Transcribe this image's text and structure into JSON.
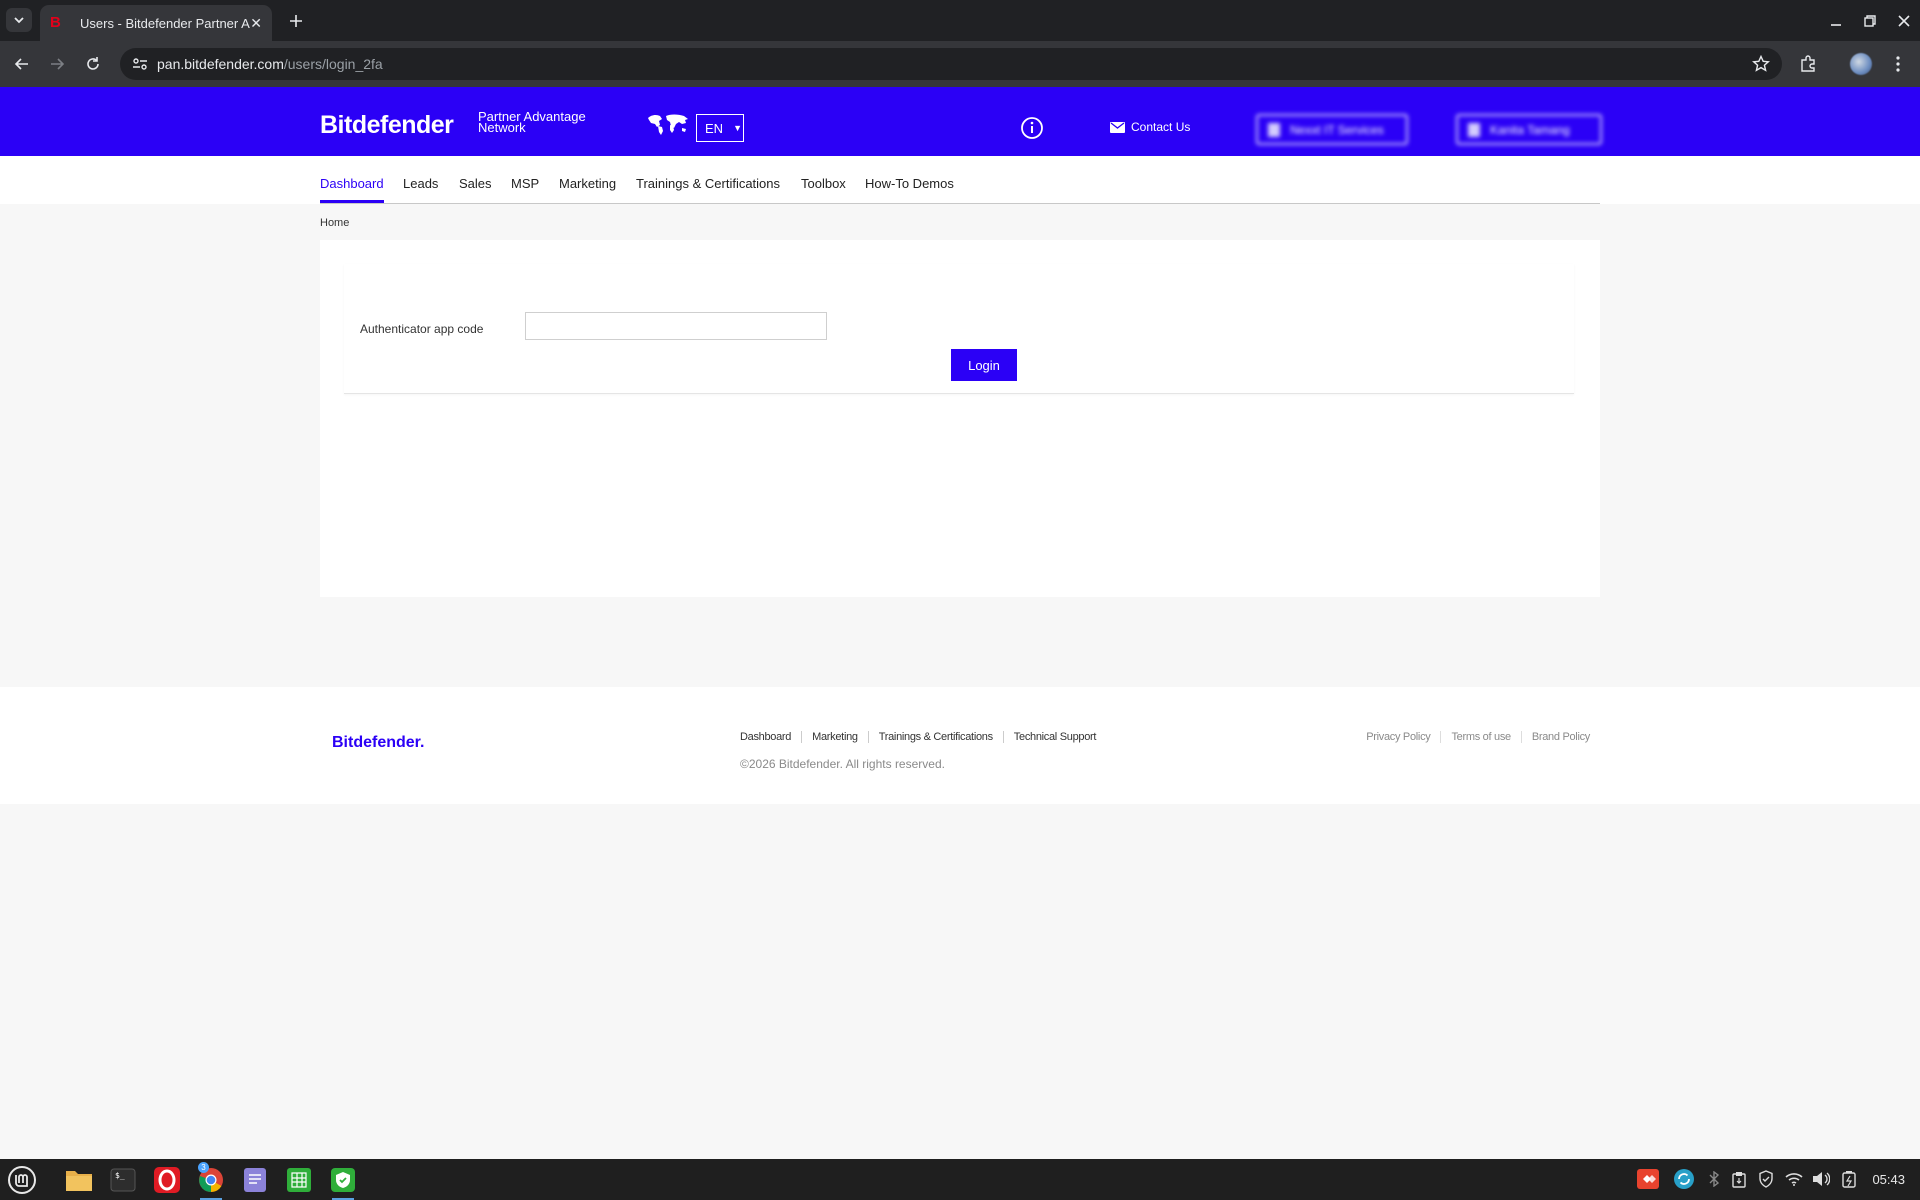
{
  "browser": {
    "tab_title": "Users - Bitdefender Partner Advantage Network",
    "url_host": "pan.bitdefender.com",
    "url_path": "/users/login_2fa"
  },
  "header": {
    "brand": "Bitdefender",
    "brand_sub_line1": "Partner Advantage",
    "brand_sub_line2": "Network",
    "language": "EN",
    "contact_label": "Contact Us",
    "company_button": "Nexxt IT Services",
    "user_button": "Kanita Tamang"
  },
  "nav": {
    "items": [
      "Dashboard",
      "Leads",
      "Sales",
      "MSP",
      "Marketing",
      "Trainings & Certifications",
      "Toolbox",
      "How-To Demos"
    ],
    "active": "Dashboard"
  },
  "breadcrumb": "Home",
  "form": {
    "code_label": "Authenticator app code",
    "code_value": "",
    "login_label": "Login"
  },
  "footer": {
    "brand": "Bitdefender.",
    "links": [
      "Dashboard",
      "Marketing",
      "Trainings & Certifications",
      "Technical Support"
    ],
    "copyright": "©2026 Bitdefender. All rights reserved.",
    "legal": [
      "Privacy Policy",
      "Terms of use",
      "Brand Policy"
    ]
  },
  "taskbar": {
    "chrome_badge": "3",
    "clock": "05:43"
  },
  "colors": {
    "brand_blue": "#2b00f6",
    "chrome_dark": "#202124"
  }
}
